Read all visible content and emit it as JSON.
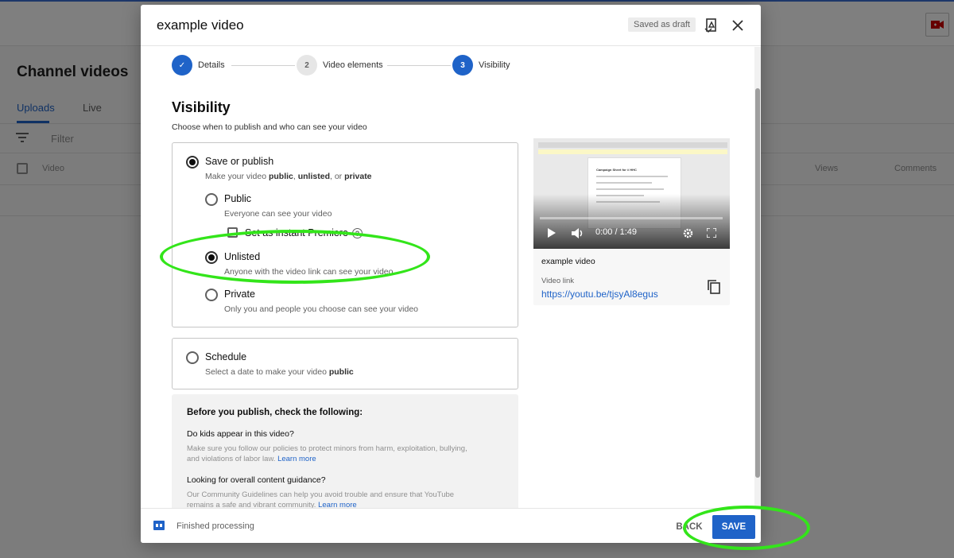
{
  "background": {
    "page_title": "Channel videos",
    "tabs": [
      "Uploads",
      "Live"
    ],
    "filter_placeholder": "Filter",
    "columns": {
      "video": "Video",
      "views": "Views",
      "comments": "Comments"
    }
  },
  "dialog": {
    "title": "example video",
    "draft_badge": "Saved as draft",
    "steps": [
      {
        "number": "✓",
        "label": "Details",
        "state": "done"
      },
      {
        "number": "2",
        "label": "Video elements",
        "state": "todo"
      },
      {
        "number": "3",
        "label": "Visibility",
        "state": "active"
      }
    ],
    "visibility": {
      "heading": "Visibility",
      "subtitle": "Choose when to publish and who can see your video",
      "save_or_publish": {
        "label": "Save or publish",
        "desc_prefix": "Make your video ",
        "desc_public": "public",
        "desc_sep1": ", ",
        "desc_unlisted": "unlisted",
        "desc_sep2": ", or ",
        "desc_private": "private",
        "selected": true
      },
      "options": {
        "public": {
          "label": "Public",
          "desc": "Everyone can see your video"
        },
        "premiere": {
          "label": "Set as instant Premiere",
          "help": "?"
        },
        "unlisted": {
          "label": "Unlisted",
          "desc": "Anyone with the video link can see your video"
        },
        "private": {
          "label": "Private",
          "desc": "Only you and people you choose can see your video"
        }
      },
      "selected_option": "unlisted",
      "schedule": {
        "label": "Schedule",
        "desc_prefix": "Select a date to make your video ",
        "desc_bold": "public"
      }
    },
    "checklist": {
      "title": "Before you publish, check the following:",
      "q1": "Do kids appear in this video?",
      "p1": "Make sure you follow our policies to protect minors from harm, exploitation, bullying, and violations of labor law.",
      "p1_link": "Learn more",
      "q2": "Looking for overall content guidance?",
      "p2": "Our Community Guidelines can help you avoid trouble and ensure that YouTube remains a safe and vibrant community.",
      "p2_link": "Learn more"
    },
    "preview": {
      "time": "0:00 / 1:49",
      "progress": 0,
      "video_title": "example video",
      "link_label": "Video link",
      "link": "https://youtu.be/tjsyAl8egus",
      "thumb_doc_title": "Campaign Sheet for # HHC"
    },
    "footer": {
      "status": "Finished processing",
      "back_label": "BACK",
      "save_label": "SAVE"
    }
  },
  "colors": {
    "accent": "#1f63c8",
    "annotation": "#33e51a"
  }
}
